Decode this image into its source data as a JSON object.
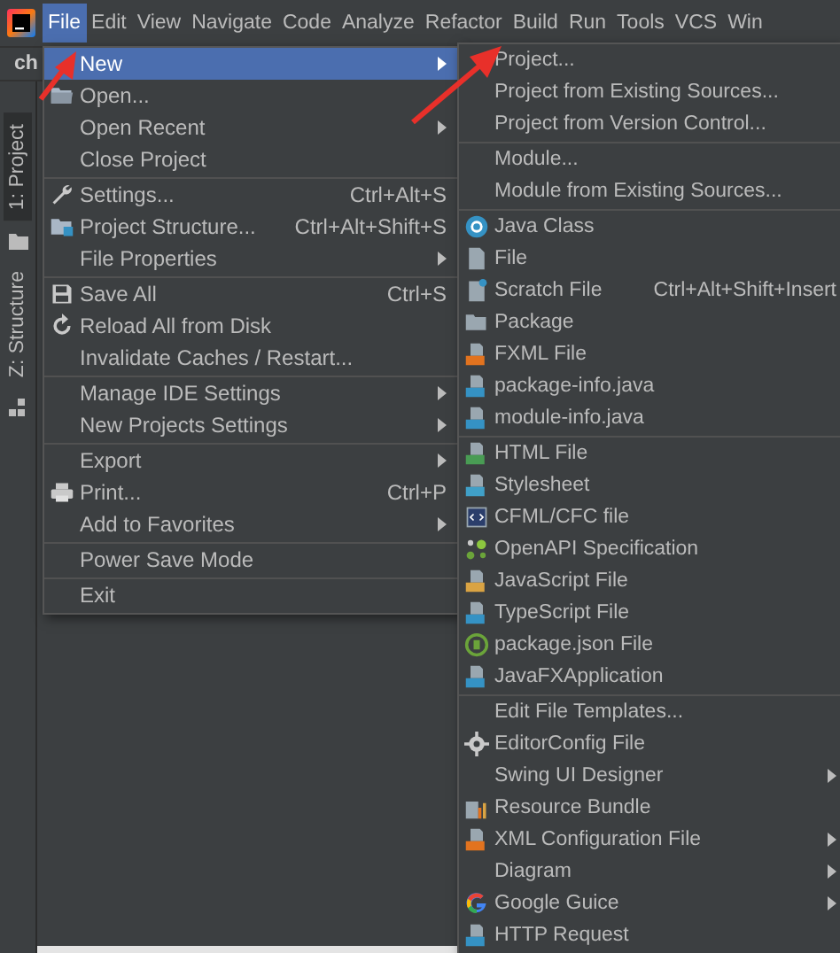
{
  "menubar": {
    "items": [
      {
        "label": "File",
        "selected": true
      },
      {
        "label": "Edit",
        "selected": false
      },
      {
        "label": "View",
        "selected": false
      },
      {
        "label": "Navigate",
        "selected": false
      },
      {
        "label": "Code",
        "selected": false
      },
      {
        "label": "Analyze",
        "selected": false
      },
      {
        "label": "Refactor",
        "selected": false
      },
      {
        "label": "Build",
        "selected": false
      },
      {
        "label": "Run",
        "selected": false
      },
      {
        "label": "Tools",
        "selected": false
      },
      {
        "label": "VCS",
        "selected": false
      },
      {
        "label": "Win",
        "selected": false
      }
    ]
  },
  "project_tab": {
    "label": "ch"
  },
  "tool_strip": [
    {
      "label": "1: Project",
      "selected": true
    },
    {
      "label": "Z: Structure",
      "selected": false
    }
  ],
  "file_menu": {
    "groups": [
      [
        {
          "label": "New",
          "submenu": true,
          "selected": true
        },
        {
          "label": "Open...",
          "selected": false
        },
        {
          "label": "Open Recent",
          "submenu": true,
          "selected": false
        },
        {
          "label": "Close Project",
          "selected": false
        }
      ],
      [
        {
          "label": "Settings...",
          "shortcut": "Ctrl+Alt+S",
          "selected": false
        },
        {
          "label": "Project Structure...",
          "shortcut": "Ctrl+Alt+Shift+S",
          "selected": false
        },
        {
          "label": "File Properties",
          "submenu": true,
          "selected": false
        }
      ],
      [
        {
          "label": "Save All",
          "shortcut": "Ctrl+S",
          "selected": false
        },
        {
          "label": "Reload All from Disk",
          "selected": false
        },
        {
          "label": "Invalidate Caches / Restart...",
          "selected": false
        }
      ],
      [
        {
          "label": "Manage IDE Settings",
          "submenu": true,
          "selected": false
        },
        {
          "label": "New Projects Settings",
          "submenu": true,
          "selected": false
        }
      ],
      [
        {
          "label": "Export",
          "submenu": true,
          "selected": false
        },
        {
          "label": "Print...",
          "shortcut": "Ctrl+P",
          "selected": false
        },
        {
          "label": "Add to Favorites",
          "submenu": true,
          "selected": false
        }
      ],
      [
        {
          "label": "Power Save Mode",
          "selected": false
        }
      ],
      [
        {
          "label": "Exit",
          "selected": false
        }
      ]
    ]
  },
  "new_menu": {
    "groups": [
      [
        {
          "label": "Project...",
          "selected": false
        },
        {
          "label": "Project from Existing Sources...",
          "selected": false
        },
        {
          "label": "Project from Version Control...",
          "selected": false
        }
      ],
      [
        {
          "label": "Module...",
          "selected": false
        },
        {
          "label": "Module from Existing Sources...",
          "selected": false
        }
      ],
      [
        {
          "label": "Java Class",
          "selected": false
        },
        {
          "label": "File",
          "selected": false
        },
        {
          "label": "Scratch File",
          "shortcut": "Ctrl+Alt+Shift+Insert",
          "selected": false
        },
        {
          "label": "Package",
          "selected": false
        },
        {
          "label": "FXML File",
          "selected": false
        },
        {
          "label": "package-info.java",
          "selected": false
        },
        {
          "label": "module-info.java",
          "selected": false
        }
      ],
      [
        {
          "label": "HTML File",
          "selected": false
        },
        {
          "label": "Stylesheet",
          "selected": false
        },
        {
          "label": "CFML/CFC file",
          "selected": false
        },
        {
          "label": "OpenAPI Specification",
          "selected": false
        },
        {
          "label": "JavaScript File",
          "selected": false
        },
        {
          "label": "TypeScript File",
          "selected": false
        },
        {
          "label": "package.json File",
          "selected": false
        },
        {
          "label": "JavaFXApplication",
          "selected": false
        }
      ],
      [
        {
          "label": "Edit File Templates...",
          "selected": false
        },
        {
          "label": "EditorConfig File",
          "selected": false
        },
        {
          "label": "Swing UI Designer",
          "submenu": true,
          "selected": false
        },
        {
          "label": "Resource Bundle",
          "selected": false
        },
        {
          "label": "XML Configuration File",
          "submenu": true,
          "selected": false
        },
        {
          "label": "Diagram",
          "submenu": true,
          "selected": false
        },
        {
          "label": "Google Guice",
          "submenu": true,
          "selected": false
        },
        {
          "label": "HTTP Request",
          "selected": false
        }
      ]
    ]
  }
}
